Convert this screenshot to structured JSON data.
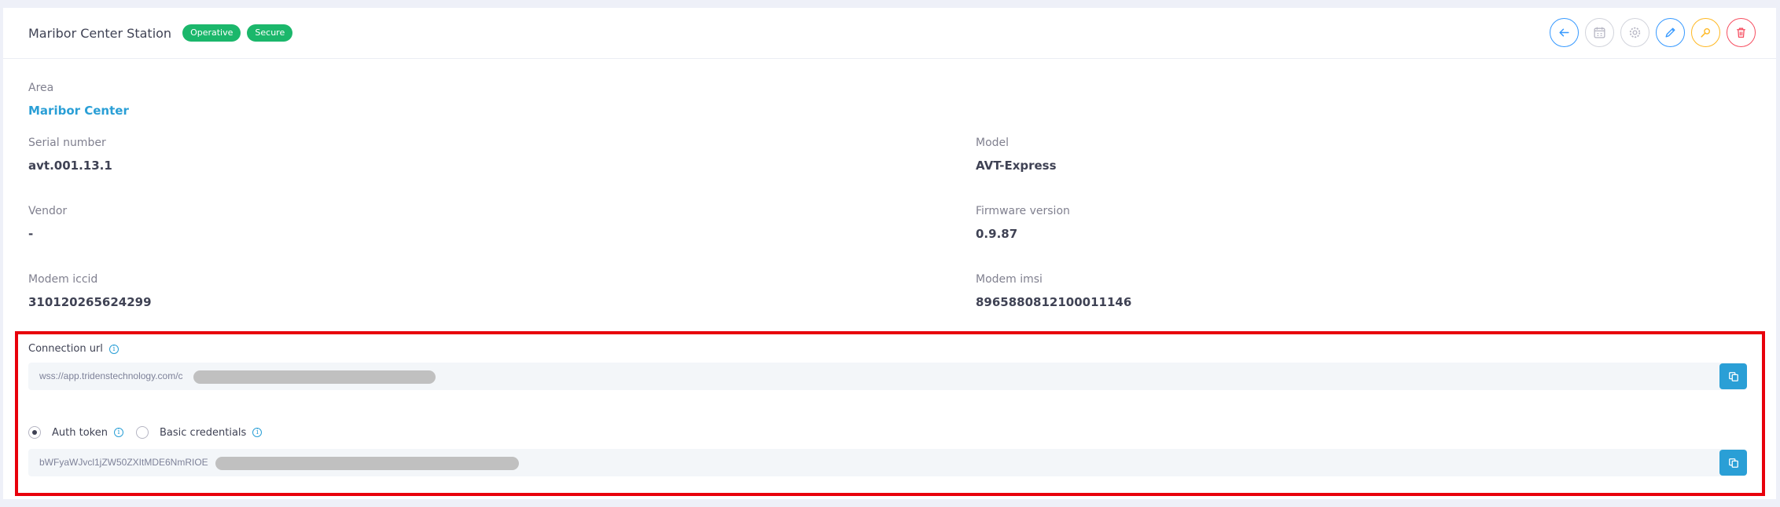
{
  "header": {
    "title": "Maribor Center Station",
    "badges": [
      "Operative",
      "Secure"
    ]
  },
  "actions": [
    {
      "name": "back",
      "icon": "arrow-left-icon"
    },
    {
      "name": "calendar",
      "icon": "calendar-icon"
    },
    {
      "name": "settings",
      "icon": "gear-icon"
    },
    {
      "name": "edit",
      "icon": "pencil-icon"
    },
    {
      "name": "pin",
      "icon": "pin-icon"
    },
    {
      "name": "delete",
      "icon": "trash-icon"
    }
  ],
  "details": {
    "area": {
      "label": "Area",
      "value": "Maribor Center"
    },
    "serial": {
      "label": "Serial number",
      "value": "avt.001.13.1"
    },
    "model": {
      "label": "Model",
      "value": "AVT-Express"
    },
    "vendor": {
      "label": "Vendor",
      "value": "-"
    },
    "firmware": {
      "label": "Firmware version",
      "value": "0.9.87"
    },
    "iccid": {
      "label": "Modem iccid",
      "value": "310120265624299"
    },
    "imsi": {
      "label": "Modem imsi",
      "value": "8965880812100011146"
    }
  },
  "connection": {
    "label": "Connection url",
    "url_visible": "wss://app.tridenstechnology.com/c",
    "auth_options": [
      {
        "label": "Auth token",
        "selected": true
      },
      {
        "label": "Basic credentials",
        "selected": false
      }
    ],
    "token_visible": "bWFyaWJvcl1jZW50ZXItMDE6NmRIOE"
  },
  "colors": {
    "accent": "#2a9fd6",
    "badge": "#1bb76b",
    "highlight": "#e8000b"
  }
}
